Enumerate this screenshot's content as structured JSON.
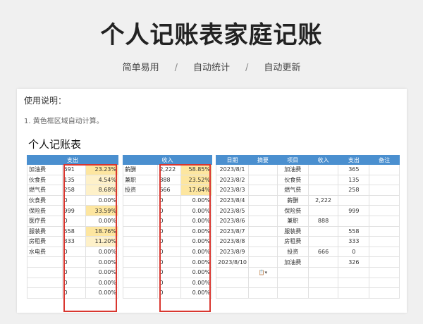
{
  "header": {
    "title": "个人记账表家庭记账",
    "subnav": [
      "简单易用",
      "自动统计",
      "自动更新"
    ],
    "separator": "/"
  },
  "sheet": {
    "usage_title": "使用说明：",
    "usage_line": "1. 黄色框区域自动计算。",
    "title": "个人记账表"
  },
  "expense_table": {
    "header": "支出",
    "rows": [
      {
        "name": "加油费",
        "amount": "691",
        "pct": "23.23%"
      },
      {
        "name": "伙食费",
        "amount": "135",
        "pct": "4.54%"
      },
      {
        "name": "燃气费",
        "amount": "258",
        "pct": "8.68%"
      },
      {
        "name": "伙食费",
        "amount": "0",
        "pct": "0.00%"
      },
      {
        "name": "保险费",
        "amount": "999",
        "pct": "33.59%"
      },
      {
        "name": "医疗费",
        "amount": "0",
        "pct": "0.00%"
      },
      {
        "name": "服装费",
        "amount": "558",
        "pct": "18.76%"
      },
      {
        "name": "房租费",
        "amount": "333",
        "pct": "11.20%"
      },
      {
        "name": "水电费",
        "amount": "0",
        "pct": "0.00%"
      },
      {
        "name": "",
        "amount": "0",
        "pct": "0.00%"
      },
      {
        "name": "",
        "amount": "0",
        "pct": "0.00%"
      },
      {
        "name": "",
        "amount": "0",
        "pct": "0.00%"
      },
      {
        "name": "",
        "amount": "0",
        "pct": "0.00%"
      }
    ]
  },
  "income_table": {
    "header": "收入",
    "rows": [
      {
        "name": "薪酬",
        "amount": "2,222",
        "pct": "58.85%"
      },
      {
        "name": "兼职",
        "amount": "888",
        "pct": "23.52%"
      },
      {
        "name": "投资",
        "amount": "666",
        "pct": "17.64%"
      },
      {
        "name": "",
        "amount": "0",
        "pct": "0.00%"
      },
      {
        "name": "",
        "amount": "0",
        "pct": "0.00%"
      },
      {
        "name": "",
        "amount": "0",
        "pct": "0.00%"
      },
      {
        "name": "",
        "amount": "0",
        "pct": "0.00%"
      },
      {
        "name": "",
        "amount": "0",
        "pct": "0.00%"
      },
      {
        "name": "",
        "amount": "0",
        "pct": "0.00%"
      },
      {
        "name": "",
        "amount": "0",
        "pct": "0.00%"
      },
      {
        "name": "",
        "amount": "0",
        "pct": "0.00%"
      },
      {
        "name": "",
        "amount": "0",
        "pct": "0.00%"
      },
      {
        "name": "",
        "amount": "0",
        "pct": "0.00%"
      }
    ]
  },
  "ledger": {
    "columns": [
      "日期",
      "摘要",
      "项目",
      "收入",
      "支出",
      "备注"
    ],
    "rows": [
      {
        "date": "2023/8/1",
        "memo": "",
        "item": "加油费",
        "income": "",
        "expense": "365",
        "note": ""
      },
      {
        "date": "2023/8/2",
        "memo": "",
        "item": "伙食费",
        "income": "",
        "expense": "135",
        "note": ""
      },
      {
        "date": "2023/8/3",
        "memo": "",
        "item": "燃气费",
        "income": "",
        "expense": "258",
        "note": ""
      },
      {
        "date": "2023/8/4",
        "memo": "",
        "item": "薪酬",
        "income": "2,222",
        "expense": "",
        "note": ""
      },
      {
        "date": "2023/8/5",
        "memo": "",
        "item": "保险费",
        "income": "",
        "expense": "999",
        "note": ""
      },
      {
        "date": "2023/8/6",
        "memo": "",
        "item": "兼职",
        "income": "888",
        "expense": "",
        "note": ""
      },
      {
        "date": "2023/8/7",
        "memo": "",
        "item": "服装费",
        "income": "",
        "expense": "558",
        "note": ""
      },
      {
        "date": "2023/8/8",
        "memo": "",
        "item": "房租费",
        "income": "",
        "expense": "333",
        "note": ""
      },
      {
        "date": "2023/8/9",
        "memo": "",
        "item": "投资",
        "income": "666",
        "expense": "0",
        "note": ""
      },
      {
        "date": "2023/8/10",
        "memo": "",
        "item": "加油费",
        "income": "",
        "expense": "326",
        "note": ""
      },
      {
        "date": "",
        "memo": "",
        "item": "",
        "income": "",
        "expense": "",
        "note": ""
      },
      {
        "date": "",
        "memo": "",
        "item": "",
        "income": "",
        "expense": "",
        "note": ""
      },
      {
        "date": "",
        "memo": "",
        "item": "",
        "income": "",
        "expense": "",
        "note": ""
      }
    ],
    "paste_icon": "paste-options-icon"
  }
}
